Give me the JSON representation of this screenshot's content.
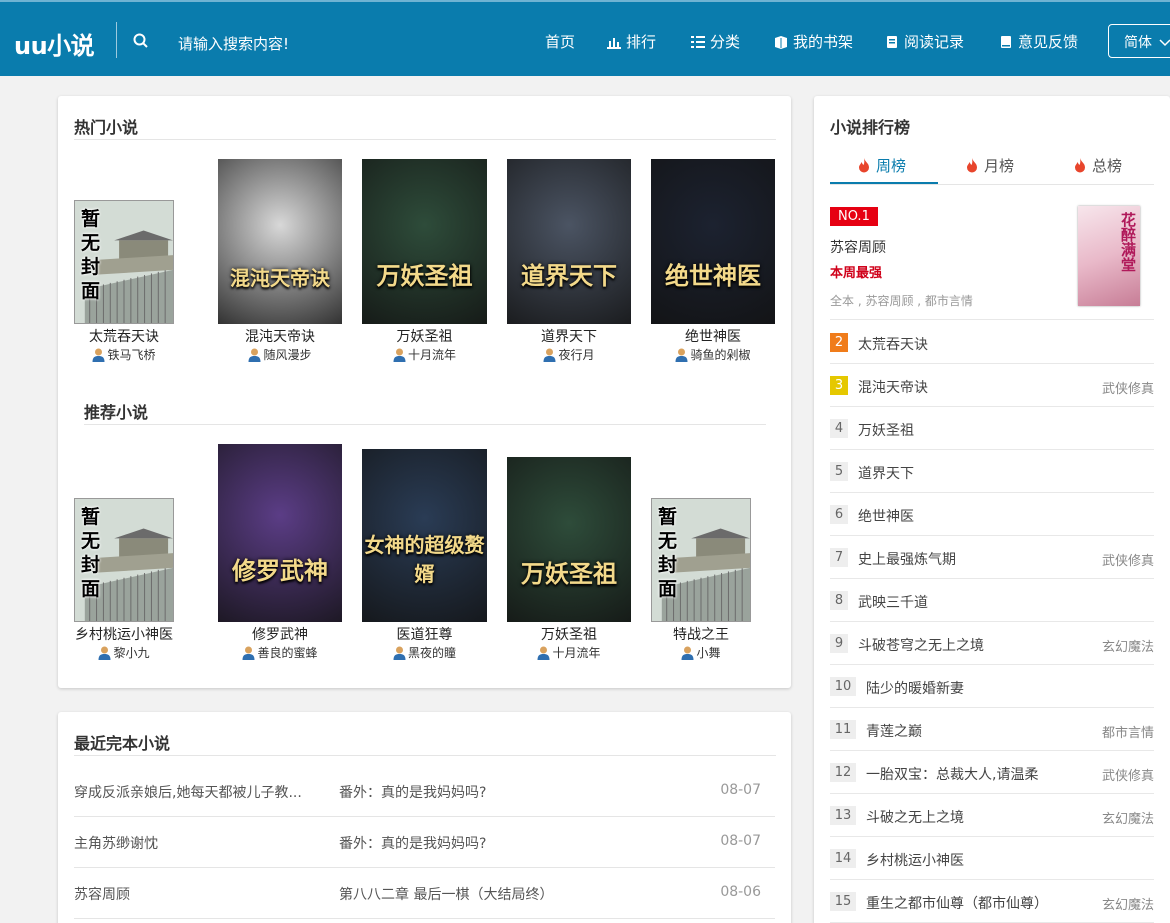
{
  "header": {
    "logo": "uu小说",
    "search_placeholder": "请输入搜索内容!",
    "nav": [
      {
        "label": "首页",
        "icon": "home"
      },
      {
        "label": "排行",
        "icon": "bar-chart-icon"
      },
      {
        "label": "分类",
        "icon": "list-icon"
      },
      {
        "label": "我的书架",
        "icon": "bookshelf-icon"
      },
      {
        "label": "阅读记录",
        "icon": "history-icon"
      },
      {
        "label": "意见反馈",
        "icon": "book-icon"
      }
    ],
    "lang": "简体"
  },
  "hot": {
    "title": "热门小说",
    "books": [
      {
        "title": "太荒吞天诀",
        "author": "铁马飞桥",
        "cover": "nocover"
      },
      {
        "title": "混沌天帝诀",
        "author": "随风漫步",
        "cover": "混沌天帝诀",
        "cover_color": "#d8d8d8"
      },
      {
        "title": "万妖圣祖",
        "author": "十月流年",
        "cover": "万妖圣祖",
        "cover_color": "#2e4c3a"
      },
      {
        "title": "道界天下",
        "author": "夜行月",
        "cover": "道界天下",
        "cover_color": "#4b5463"
      },
      {
        "title": "绝世神医",
        "author": "骑鱼的剁椒",
        "cover": "绝世神医",
        "cover_color": "#1c2230"
      }
    ]
  },
  "recommend": {
    "title": "推荐小说",
    "books": [
      {
        "title": "乡村桃运小神医",
        "author": "黎小九",
        "cover": "nocover"
      },
      {
        "title": "修罗武神",
        "author": "善良的蜜蜂",
        "cover": "修罗武神",
        "cover_color": "#5b3d86"
      },
      {
        "title": "医道狂尊",
        "author": "黑夜的瞳",
        "cover": "女神的超级赘婿",
        "cover_color": "#2a3c55"
      },
      {
        "title": "万妖圣祖",
        "author": "十月流年",
        "cover": "万妖圣祖",
        "cover_color": "#2e4c3a"
      },
      {
        "title": "特战之王",
        "author": "小舞",
        "cover": "nocover"
      }
    ]
  },
  "nocover_text": "暂无封面",
  "completed": {
    "title": "最近完本小说",
    "rows": [
      {
        "name": "穿成反派亲娘后,她每天都被儿子教...",
        "chapter": "番外：真的是我妈妈吗?",
        "date": "08-07"
      },
      {
        "name": "主角苏缈谢忱",
        "chapter": "番外：真的是我妈妈吗?",
        "date": "08-07"
      },
      {
        "name": "苏容周顾",
        "chapter": "第八八二章 最后一棋（大结局终）",
        "date": "08-06"
      }
    ]
  },
  "ranking": {
    "title": "小说排行榜",
    "tabs": [
      "周榜",
      "月榜",
      "总榜"
    ],
    "top": {
      "badge": "NO.1",
      "name": "苏容周顾",
      "tag": "本周最强",
      "meta": "全本 , 苏容周顾 , 都市言情",
      "cover_text": "花醉满堂"
    },
    "items": [
      {
        "num": "2",
        "name": "太荒吞天诀",
        "cat": ""
      },
      {
        "num": "3",
        "name": "混沌天帝诀",
        "cat": "武侠修真"
      },
      {
        "num": "4",
        "name": "万妖圣祖",
        "cat": ""
      },
      {
        "num": "5",
        "name": "道界天下",
        "cat": ""
      },
      {
        "num": "6",
        "name": "绝世神医",
        "cat": ""
      },
      {
        "num": "7",
        "name": "史上最强炼气期",
        "cat": "武侠修真"
      },
      {
        "num": "8",
        "name": "武映三千道",
        "cat": ""
      },
      {
        "num": "9",
        "name": "斗破苍穹之无上之境",
        "cat": "玄幻魔法"
      },
      {
        "num": "10",
        "name": "陆少的暖婚新妻",
        "cat": ""
      },
      {
        "num": "11",
        "name": "青莲之巅",
        "cat": "都市言情"
      },
      {
        "num": "12",
        "name": "一胎双宝：总裁大人,请温柔",
        "cat": "武侠修真"
      },
      {
        "num": "13",
        "name": "斗破之无上之境",
        "cat": "玄幻魔法"
      },
      {
        "num": "14",
        "name": "乡村桃运小神医",
        "cat": ""
      },
      {
        "num": "15",
        "name": "重生之都市仙尊（都市仙尊）",
        "cat": "玄幻魔法"
      }
    ]
  },
  "colors": {
    "header": "#0a7cad",
    "rank2": "#f07c1a",
    "rank3": "#e5c800",
    "badge": "#e60012",
    "tag": "#d0021b",
    "flame": "#e8452c"
  }
}
